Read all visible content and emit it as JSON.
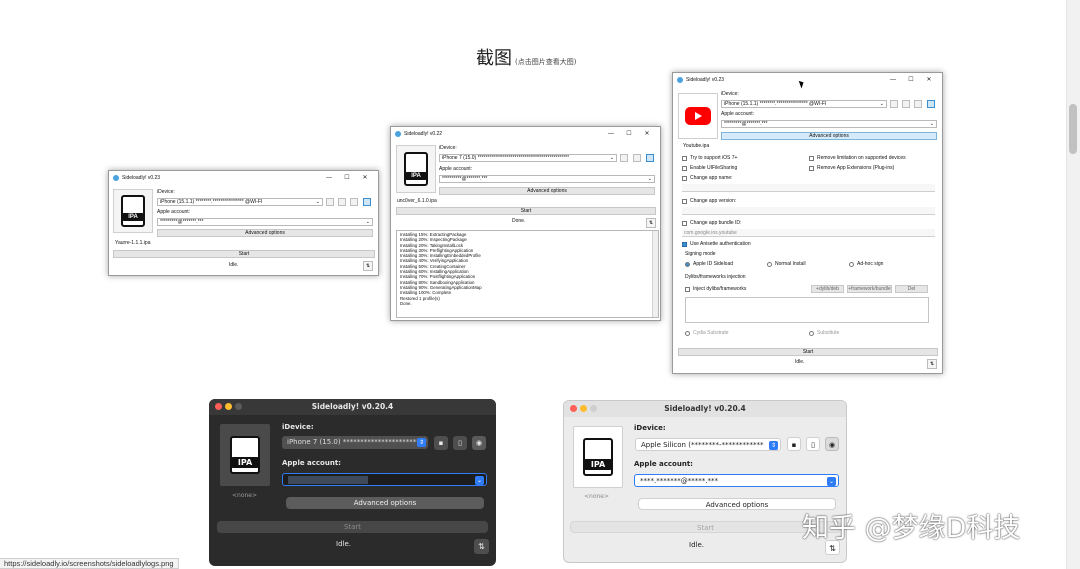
{
  "heading": {
    "title": "截图",
    "hint": "(点击图片查看大图)"
  },
  "win1": {
    "title": "Sideloadly! v0.23",
    "device_label": "iDevice:",
    "device_value": "iPhone (15.1.1) ********.**************** @WI-FI",
    "apple_label": "Apple account:",
    "apple_value": "*********@*******.***",
    "advanced": "Advanced options",
    "filename": "Yaurre-1.1.1.ipa",
    "start": "Start",
    "status": "Idle.",
    "ipa_tag": "IPA"
  },
  "win2": {
    "title": "Sideloadly! v0.22",
    "device_label": "iDevice:",
    "device_value": "iPhone 7 (15.0) ***********************************************",
    "apple_label": "Apple account:",
    "apple_value": "**********@*******.***",
    "advanced": "Advanced options",
    "filename": "unc0ver_6.1.0.ipa",
    "start": "Start",
    "status": "Done.",
    "ipa_tag": "IPA",
    "log": [
      "Installing 15%: ExtractingPackage",
      "Installing 20%: InspectingPackage",
      "Installing 20%: TakingInstallLock",
      "Installing 30%: PreflightingApplication",
      "Installing 30%: InstallingEmbeddedProfile",
      "Installing 40%: VerifyingApplication",
      "Installing 50%: CreatingContainer",
      "Installing 60%: InstallingApplication",
      "Installing 70%: PostflightingApplication",
      "Installing 80%: SandboxingApplication",
      "Installing 90%: GeneratingApplicationMap",
      "Installing 100%: Complete",
      "Restored 1 profile(s)",
      "Done."
    ]
  },
  "win3": {
    "title": "Sideloadly! v0.23",
    "device_label": "iDevice:",
    "device_value": "iPhone (15.1.1) ********.**************** @WI-FI",
    "apple_label": "Apple account:",
    "apple_value": "*********@*******.***",
    "advanced": "Advanced options",
    "filename": "Youtube.ipa",
    "opt_ios7": "Try to support iOS 7+",
    "opt_limit": "Remove limitation on supported devices",
    "opt_file": "Enable UIFileSharing",
    "opt_ext": "Remove App Extensions (Plug-ins)",
    "opt_name": "Change app name:",
    "opt_version": "Change app version:",
    "opt_bundle": "Change app bundle ID:",
    "bundle_value": "com.google.ios.youtube",
    "opt_anisette": "Use Anisette authentication",
    "signing_mode": "Signing mode",
    "sign_appleid": "Apple ID Sideload",
    "sign_normal": "Normal Install",
    "sign_adhoc": "Ad-hoc sign",
    "dylibs_title": "Dylibs/frameworks injection",
    "inject": "Inject dylibs/frameworks",
    "add_dylib": "+dylib/deb",
    "add_fw": "+framework/bundle",
    "del": "Del",
    "cydia": "Cydia Substrate",
    "substitute": "Substitute",
    "start": "Start",
    "status": "Idle."
  },
  "mac_dark": {
    "title": "Sideloadly! v0.20.4",
    "device_label": "iDevice:",
    "device_value": "iPhone 7 (15.0) ************************",
    "apple_label": "Apple account:",
    "advanced": "Advanced options",
    "none": "<none>",
    "start": "Start",
    "status": "Idle.",
    "ipa_tag": "IPA"
  },
  "mac_light": {
    "title": "Sideloadly! v0.20.4",
    "device_label": "iDevice:",
    "device_value": "Apple Silicon (********-************",
    "apple_label": "Apple account:",
    "apple_value": "****.*******@*****.***",
    "advanced": "Advanced options",
    "none": "<none>",
    "start": "Start",
    "status": "Idle.",
    "ipa_tag": "IPA"
  },
  "watermark": "知乎 @梦缘D科技",
  "status_url": "https://sideloadly.io/screenshots/sideloadlylogs.png",
  "colors": {
    "accent": "#3b8fd0",
    "mac_dark_bg": "#2b2b2b",
    "mac_light_bg": "#ececec",
    "youtube_red": "#ff0000"
  }
}
